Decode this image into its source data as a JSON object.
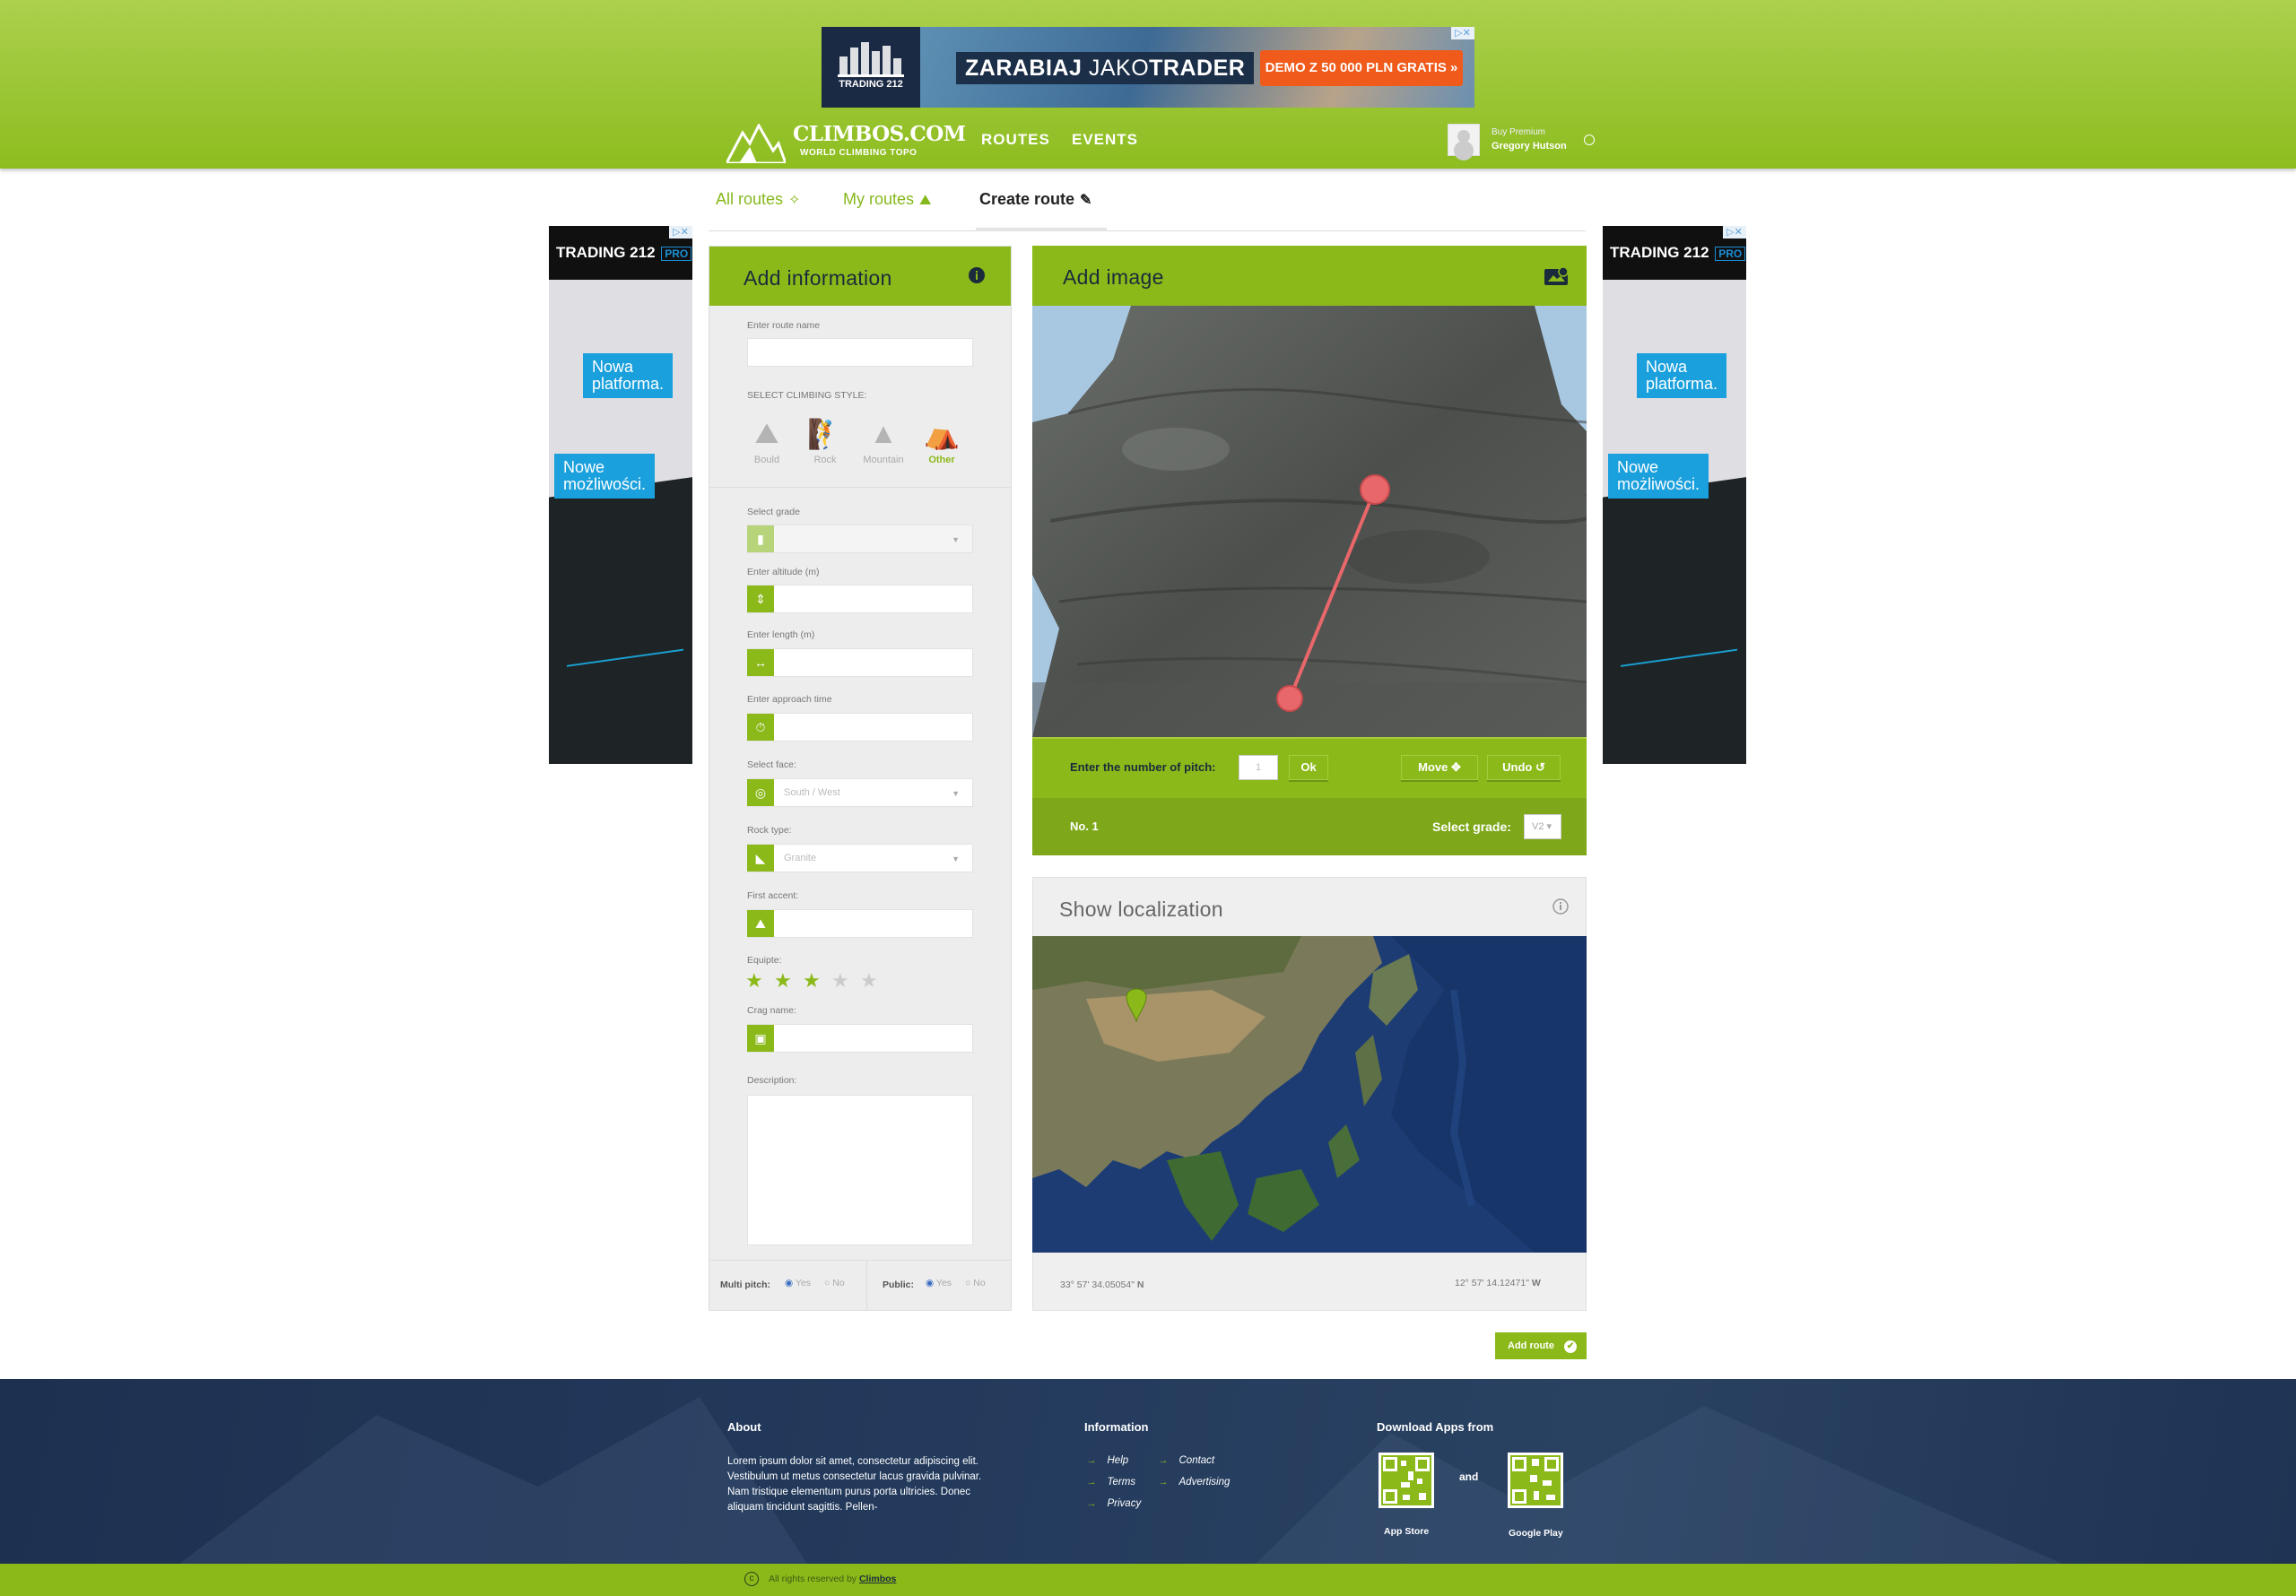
{
  "top_ad": {
    "brand": "TRADING 212",
    "headline_bold": "ZARABIAJ",
    "headline_mid": " JAKO",
    "headline_end": "TRADER",
    "cta": "DEMO Z 50 000 PLN GRATIS »"
  },
  "brand": {
    "name": "CLIMBOS.COM",
    "tagline": "WORLD CLIMBING TOPO"
  },
  "nav": {
    "routes": "ROUTES",
    "events": "EVENTS"
  },
  "user": {
    "buy_premium": "Buy Premium",
    "name": "Gregory Hutson"
  },
  "tabs": [
    {
      "label": "All routes",
      "active": false
    },
    {
      "label": "My routes",
      "active": false
    },
    {
      "label": "Create route",
      "active": true
    }
  ],
  "side_ads": {
    "brand": "TRADING 212",
    "pro": "PRO",
    "line1a": "Nowa",
    "line1b": "platforma.",
    "line2a": "Nowe",
    "line2b": "możliwości."
  },
  "info": {
    "title": "Add information",
    "route_name_label": "Enter route name",
    "style_label": "SELECT CLIMBING STYLE:",
    "styles": [
      "Bould",
      "Rock",
      "Mountain",
      "Other"
    ],
    "selected_style": "Other",
    "grade_label": "Select grade",
    "altitude_label": "Enter altitude (m)",
    "length_label": "Enter length (m)",
    "approach_label": "Enter approach time",
    "face_label": "Select face:",
    "face_value": "South / West",
    "rock_label": "Rock type:",
    "rock_value": "Granite",
    "accent_label": "First accent:",
    "equip_label": "Equipte:",
    "equip_rating": 3,
    "crag_label": "Crag name:",
    "desc_label": "Description:",
    "multi_pitch_label": "Multi pitch:",
    "public_label": "Public:",
    "yes": "Yes",
    "no": "No"
  },
  "image": {
    "title": "Add image",
    "pitch_label": "Enter the number of pitch:",
    "pitch_value": "1",
    "ok": "Ok",
    "move": "Move",
    "undo": "Undo",
    "pitch_no": "No. 1",
    "grade_label": "Select grade:",
    "grade_value": "V2"
  },
  "map": {
    "title": "Show localization",
    "lat": "33° 57' 34.05054\"",
    "lat_dir": "N",
    "lon": "12° 57' 14.12471\"",
    "lon_dir": "W"
  },
  "add_route": "Add route",
  "footer": {
    "about_title": "About",
    "about_text": "Lorem ipsum dolor sit amet, consectetur adipiscing elit. Vestibulum ut metus consectetur lacus gravida pulvinar. Nam tristique elementum purus porta ultricies. Donec aliquam tincidunt sagittis. Pellen-",
    "info_title": "Information",
    "links_left": [
      "Help",
      "Terms",
      "Privacy"
    ],
    "links_right": [
      "Contact",
      "Advertising"
    ],
    "apps_title": "Download Apps from",
    "and": "and",
    "app_store": "App Store",
    "google_play": "Google Play",
    "copyright": "All rights reserved by",
    "copyright_brand": "Climbos"
  },
  "colors": {
    "accent": "#8bb91a",
    "header_top": "#acd04e",
    "footer": "#233a5c",
    "route_line": "#e8676a"
  }
}
